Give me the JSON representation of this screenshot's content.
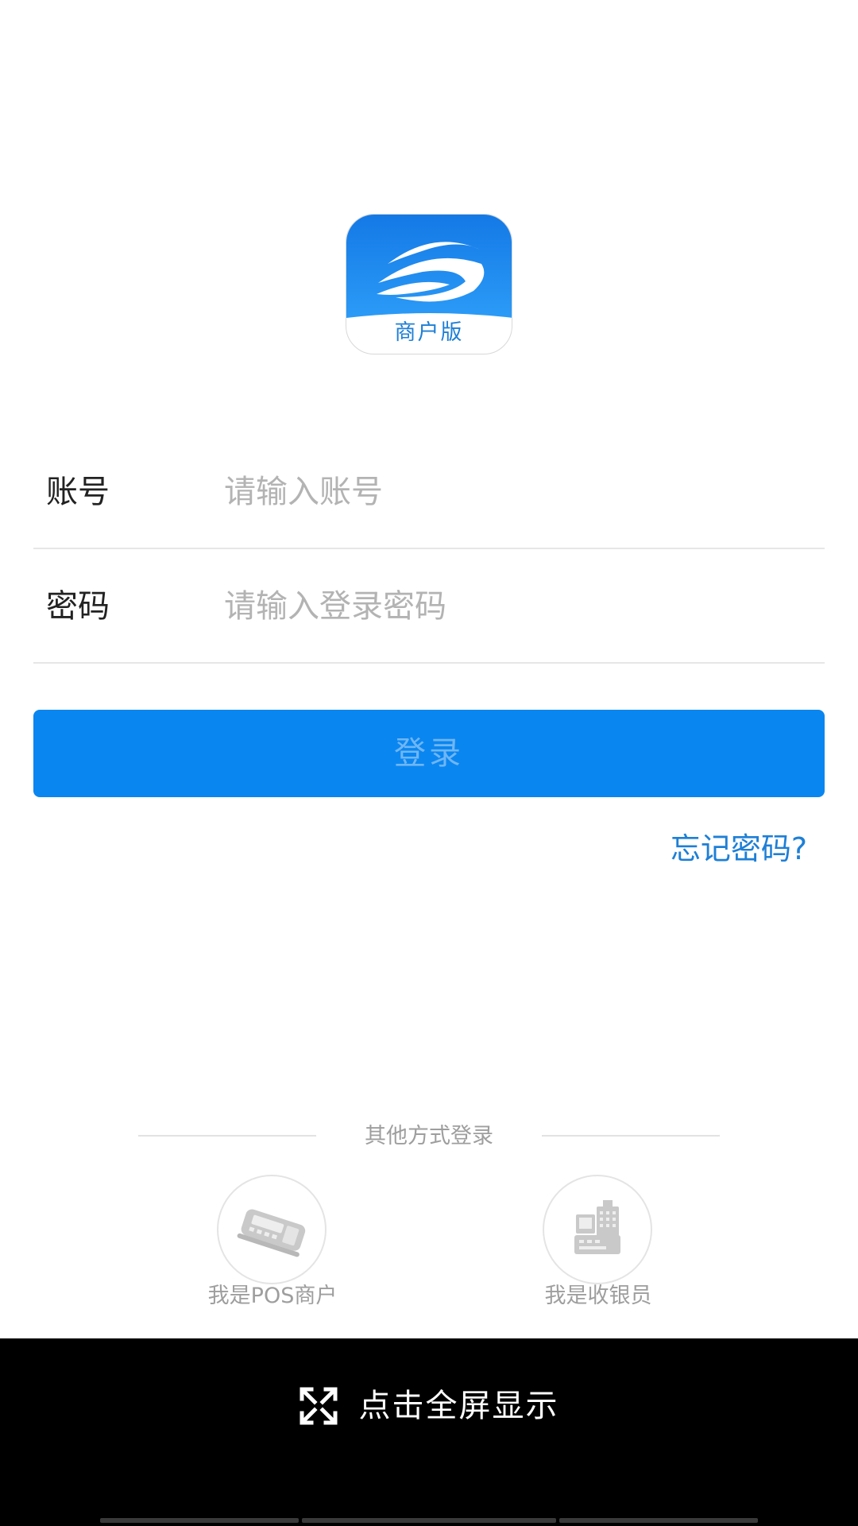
{
  "app": {
    "logo_label": "商户版",
    "brand_color": "#1e88e5"
  },
  "form": {
    "account": {
      "label": "账号",
      "placeholder": "请输入账号",
      "value": ""
    },
    "password": {
      "label": "密码",
      "placeholder": "请输入登录密码",
      "value": ""
    },
    "login_button": "登录",
    "forgot_password": "忘记密码?"
  },
  "other_login": {
    "title": "其他方式登录",
    "methods": [
      {
        "label": "我是POS商户",
        "icon": "pos-terminal-icon"
      },
      {
        "label": "我是收银员",
        "icon": "cash-register-icon"
      }
    ]
  },
  "bottom_bar": {
    "fullscreen_label": "点击全屏显示",
    "icon": "expand-icon"
  },
  "colors": {
    "primary": "#0a86f0",
    "link": "#1e7fd6",
    "muted_text": "#9e9e9e",
    "placeholder": "#b3b3b3"
  }
}
